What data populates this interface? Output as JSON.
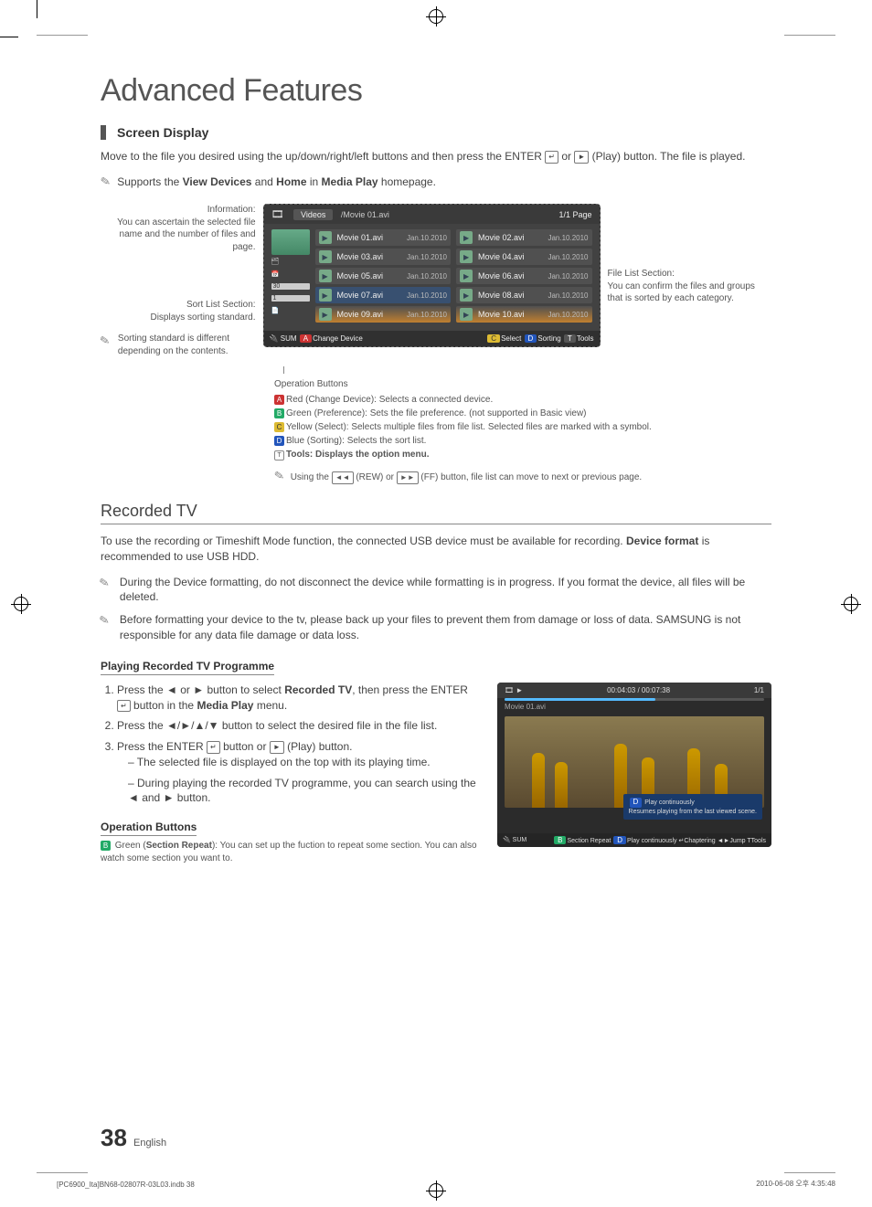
{
  "page_title": "Advanced Features",
  "screen_display": {
    "heading": "Screen Display",
    "intro_1": "Move to the file you desired using the up/down/right/left buttons and then press the ENTER",
    "intro_2": "or",
    "intro_3": "(Play) button. The file is played.",
    "support_note": "Supports the View Devices and Home in Media Play homepage.",
    "support_bold_1": "View Devices",
    "support_bold_2": "Home",
    "support_bold_3": "Media Play"
  },
  "diagram_labels": {
    "info_title": "Information:",
    "info_body": "You can ascertain the selected file name and the number of files and page.",
    "sort_title": "Sort List Section:",
    "sort_body": "Displays sorting standard.",
    "sort_note": "Sorting standard is different depending on the contents.",
    "file_title": "File List Section:",
    "file_body": "You can confirm the files and groups that is sorted by each category."
  },
  "tv_ui": {
    "category": "Videos",
    "breadcrumb": "/Movie 01.avi",
    "page": "1/1 Page",
    "footer_left": "SUM",
    "footer_a": "Change Device",
    "footer_select": "Select",
    "footer_sorting": "Sorting",
    "footer_tools": "Tools",
    "files": [
      {
        "l": "Movie 01.avi",
        "ld": "Jan.10.2010",
        "r": "Movie 02.avi",
        "rd": "Jan.10.2010"
      },
      {
        "l": "Movie 03.avi",
        "ld": "Jan.10.2010",
        "r": "Movie 04.avi",
        "rd": "Jan.10.2010"
      },
      {
        "l": "Movie 05.avi",
        "ld": "Jan.10.2010",
        "r": "Movie 06.avi",
        "rd": "Jan.10.2010"
      },
      {
        "l": "Movie 07.avi",
        "ld": "Jan.10.2010",
        "r": "Movie 08.avi",
        "rd": "Jan.10.2010"
      },
      {
        "l": "Movie 09.avi",
        "ld": "Jan.10.2010",
        "r": "Movie 10.avi",
        "rd": "Jan.10.2010"
      }
    ]
  },
  "operation_buttons": {
    "header": "Operation Buttons",
    "a": "Red (Change Device): Selects a connected device.",
    "b": "Green (Preference): Sets the file preference. (not supported in Basic view)",
    "c": "Yellow (Select): Selects multiple files from file list. Selected files are marked with a symbol.",
    "d": "Blue (Sorting): Selects the sort list.",
    "tools": "Tools: Displays the option menu.",
    "rew_note_1": "Using the",
    "rew_note_2": "(REW) or",
    "rew_note_3": "(FF) button, file list can move to next or previous page."
  },
  "recorded_tv": {
    "heading": "Recorded TV",
    "intro_1": "To use the recording or Timeshift Mode function, the connected USB device must be available for recording.",
    "intro_bold": "Device format",
    "intro_2": "is recommended to use USB HDD.",
    "note1": "During the Device formatting, do not disconnect the device while formatting is in progress. If you format the device, all files will be deleted.",
    "note2": "Before formatting your device to the tv, please back up your files to prevent them from damage or loss of data. SAMSUNG is not responsible for any data file damage or data loss.",
    "play_head": "Playing Recorded TV Programme",
    "step1_a": "Press the ◄ or ► button to select",
    "step1_bold": "Recorded TV",
    "step1_b": ", then press the ENTER",
    "step1_c": "button in the",
    "step1_bold2": "Media Play",
    "step1_d": "menu.",
    "step2": "Press the ◄/►/▲/▼ button to select the desired file in the file list.",
    "step3_a": "Press the ENTER",
    "step3_b": "button or",
    "step3_c": "(Play) button.",
    "sub1": "The selected file is displayed on the top with its playing time.",
    "sub2": "During playing the recorded TV programme, you can search using the ◄ and ► button.",
    "op_head": "Operation Buttons",
    "op_b_pre": "Green (",
    "op_b_bold": "Section Repeat",
    "op_b_post": "): You can set up the fuction to repeat some section. You can also watch some section you want to."
  },
  "player": {
    "time": "00:04:03 / 00:07:38",
    "page": "1/1",
    "filename": "Movie 01.avi",
    "tip_title": "Play continuously",
    "tip_body": "Resumes playing from the last viewed scene.",
    "foot_sum": "SUM",
    "foot_b": "Section Repeat",
    "foot_d": "Play continuously",
    "foot_chap": "Chaptering",
    "foot_jump": "Jump",
    "foot_tools": "Tools",
    "d_label": "D"
  },
  "footer": {
    "page_no": "38",
    "lang": "English",
    "left_text": "[PC6900_Ita]BN68-02807R-03L03.indb   38",
    "right_text": "2010-06-08   오후 4:35:48"
  }
}
